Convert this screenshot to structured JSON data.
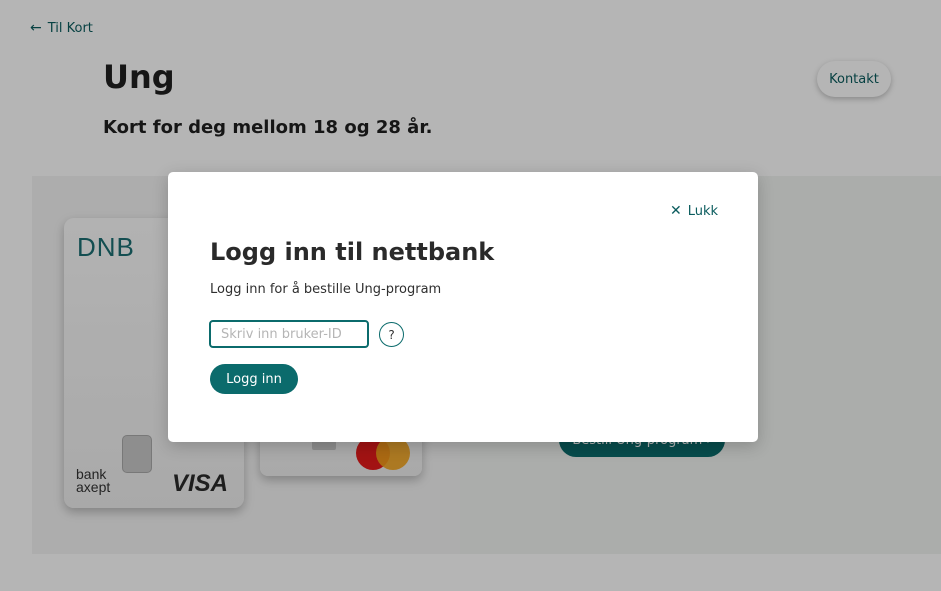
{
  "nav": {
    "back_arrow": "←",
    "back_label": "Til Kort"
  },
  "page": {
    "title": "Ung",
    "subtitle": "Kort for deg mellom 18 og 28 år.",
    "contact_label": "Kontakt"
  },
  "hero": {
    "card1_brand": "DNB",
    "card1_bankaxept": "bank\naxept",
    "card1_network": "VISA",
    "order_label": "Bestill Ung-program  ›"
  },
  "modal": {
    "close_icon": "✕",
    "close_label": "Lukk",
    "title": "Logg inn til nettbank",
    "text": "Logg inn for å bestille Ung-program",
    "input_placeholder": "Skriv inn bruker-ID",
    "input_value": "",
    "help_label": "?",
    "login_label": "Logg inn"
  },
  "colors": {
    "accent": "#0b6b6c",
    "link": "#0b5c5e",
    "overlay": "rgba(0,0,0,0.29)"
  }
}
